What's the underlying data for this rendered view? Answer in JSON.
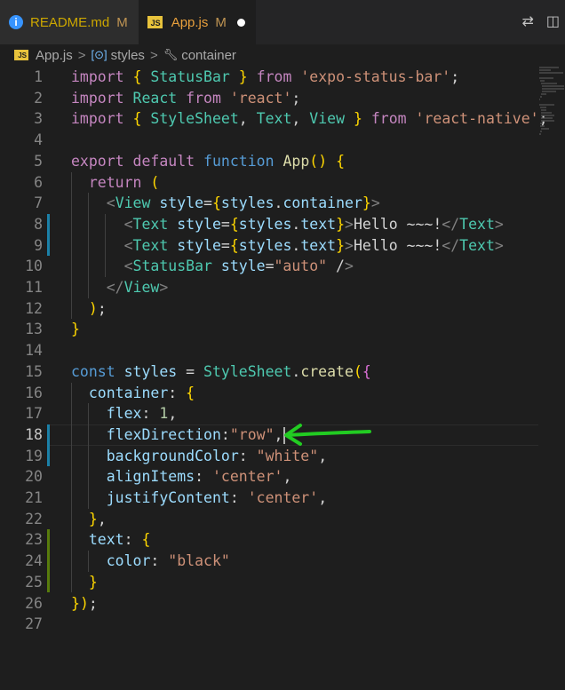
{
  "tabs": [
    {
      "name": "README.md",
      "status": "M",
      "icon": "info-icon",
      "active": false
    },
    {
      "name": "App.js",
      "status": "M",
      "icon": "js-icon",
      "active": true,
      "unsaved": true
    }
  ],
  "breadcrumb": {
    "file": "App.js",
    "symbol1": "styles",
    "symbol2": "container",
    "sep": ">"
  },
  "code_lines": [
    "import { StatusBar } from 'expo-status-bar';",
    "import React from 'react';",
    "import { StyleSheet, Text, View } from 'react-native';",
    "",
    "export default function App() {",
    "  return (",
    "    <View style={styles.container}>",
    "      <Text style={styles.text}>Hello ~~~!</Text>",
    "      <Text style={styles.text}>Hello ~~~!</Text>",
    "      <StatusBar style=\"auto\" />",
    "    </View>",
    "  );",
    "}",
    "",
    "const styles = StyleSheet.create({",
    "  container: {",
    "    flex: 1,",
    "    flexDirection:\"row\",",
    "    backgroundColor: \"white\",",
    "    alignItems: 'center',",
    "    justifyContent: 'center',",
    "  },",
    "  text: {",
    "    color: \"black\"",
    "  }",
    "});",
    ""
  ],
  "line_numbers": [
    "1",
    "2",
    "3",
    "4",
    "5",
    "6",
    "7",
    "8",
    "9",
    "10",
    "11",
    "12",
    "13",
    "14",
    "15",
    "16",
    "17",
    "18",
    "19",
    "20",
    "21",
    "22",
    "23",
    "24",
    "25",
    "26",
    "27"
  ],
  "current_line": 18,
  "annotation": {
    "type": "arrow",
    "color": "#22cc22",
    "points_to_line": 18
  }
}
